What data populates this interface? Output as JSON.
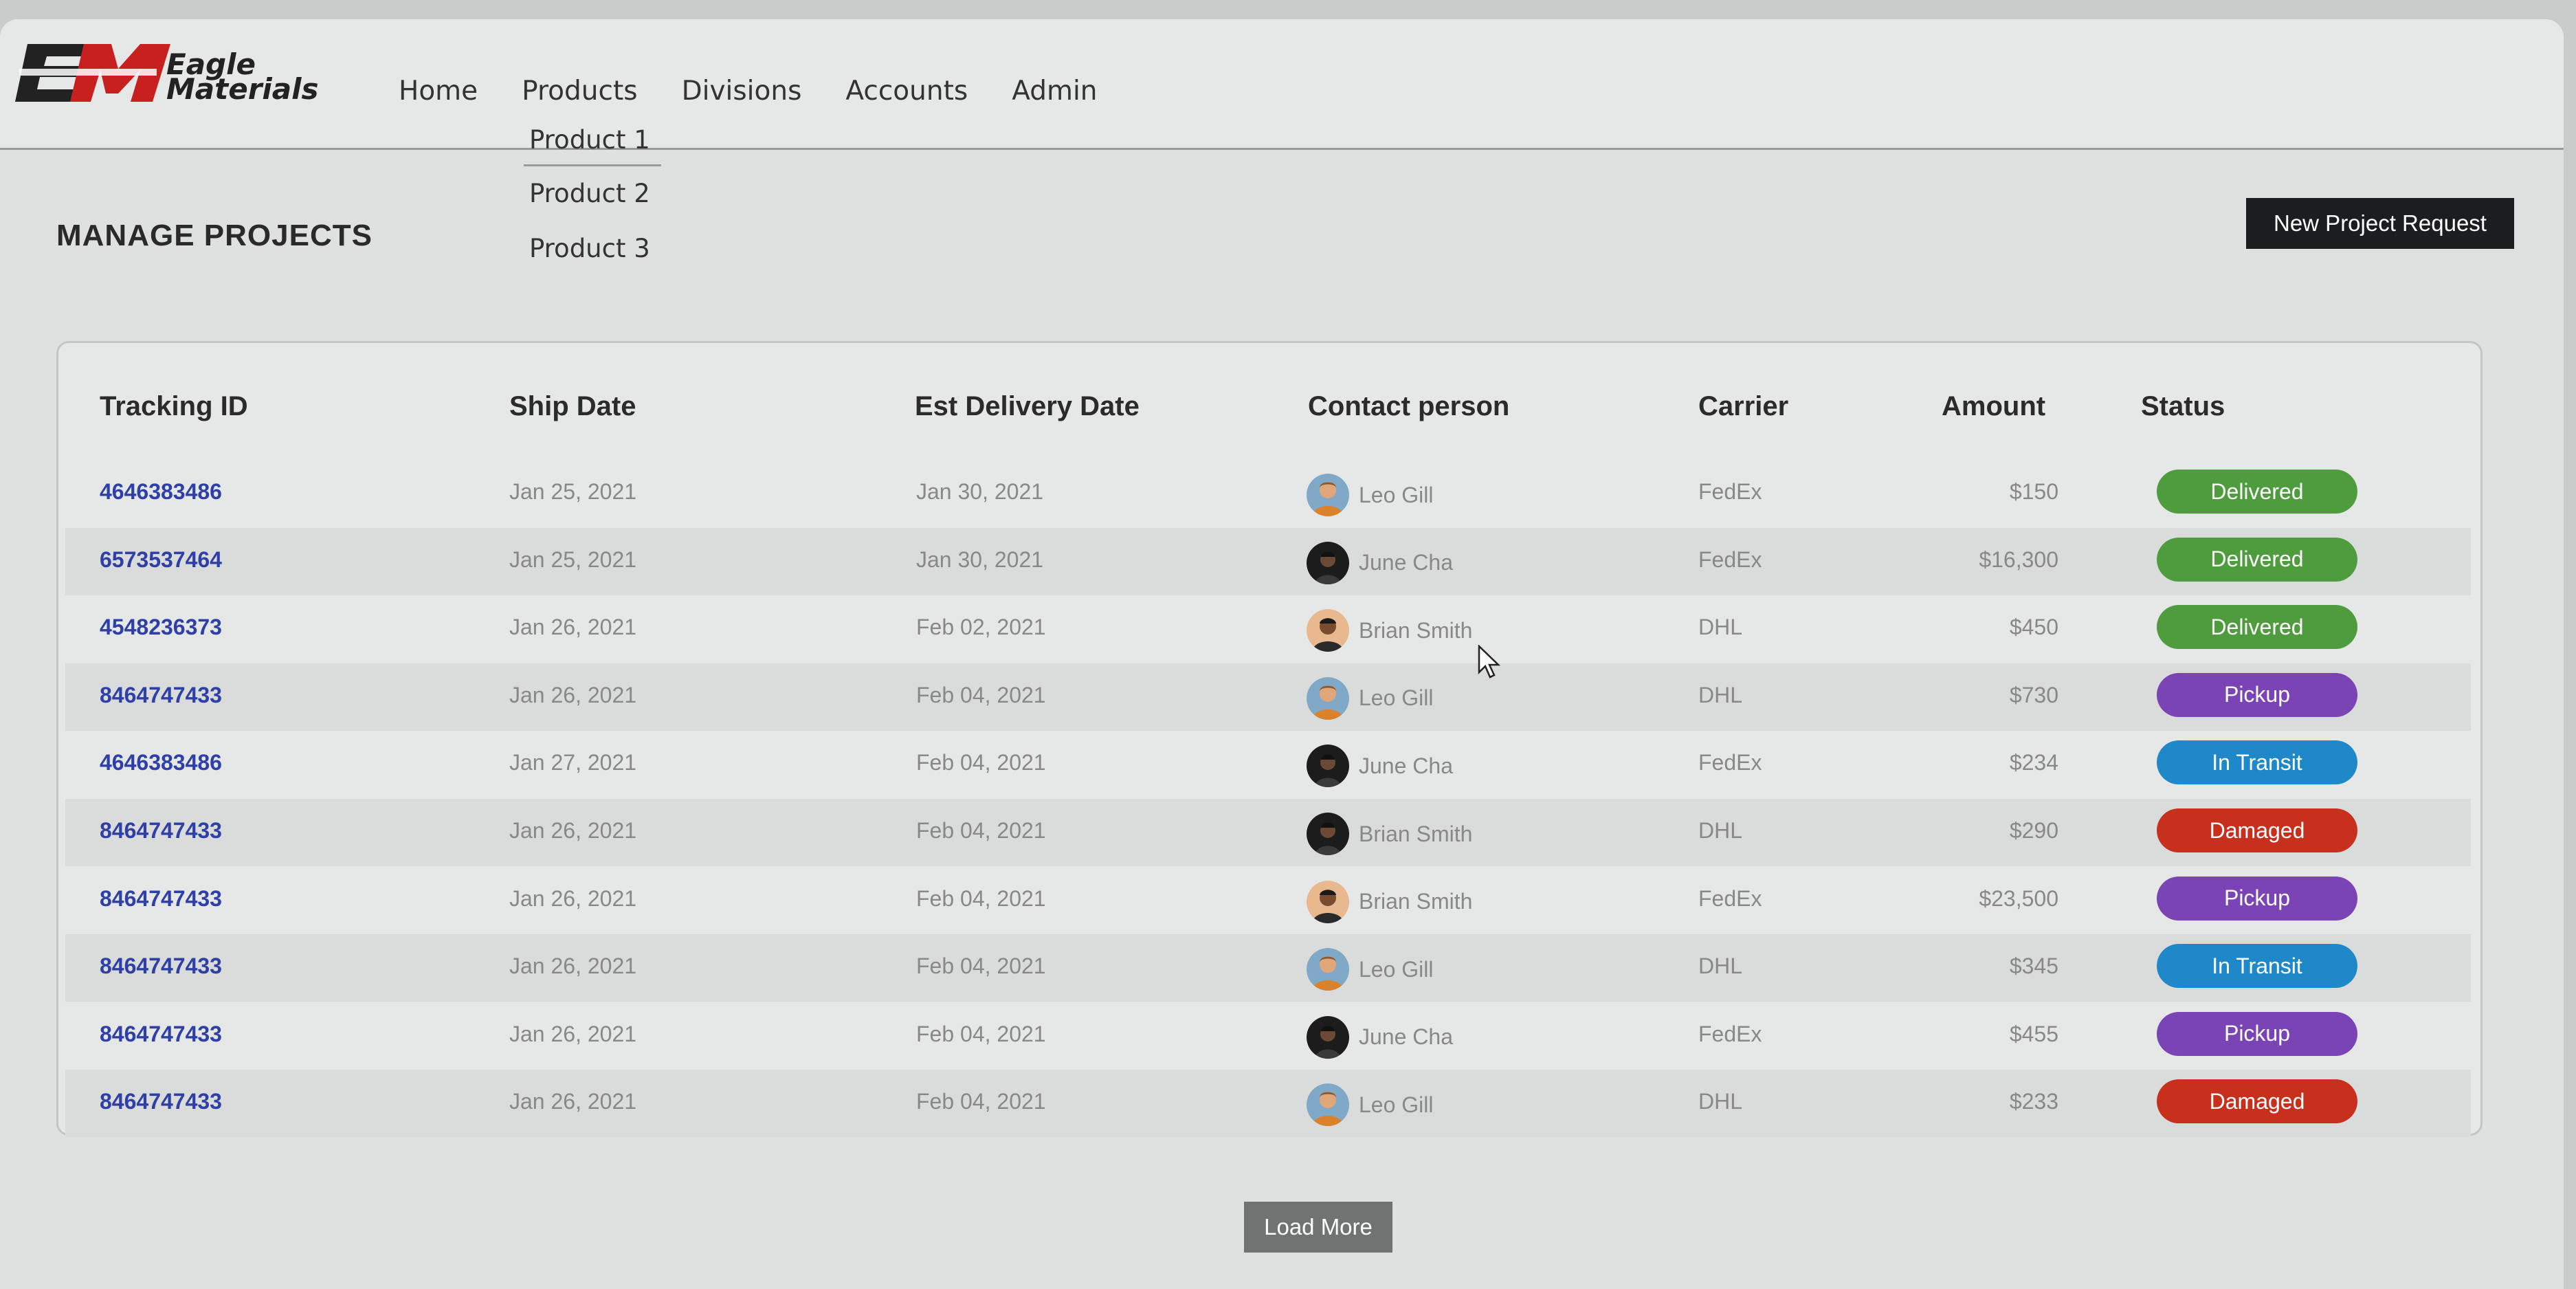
{
  "brand": {
    "name_line1": "Eagle",
    "name_line2": "Materials"
  },
  "nav": {
    "items": [
      "Home",
      "Products",
      "Divisions",
      "Accounts",
      "Admin"
    ],
    "products_dropdown": [
      "Product 1",
      "Product 2",
      "Product 3"
    ]
  },
  "page": {
    "title": "MANAGE PROJECTS",
    "new_button": "New Project Request",
    "load_more": "Load More"
  },
  "table": {
    "columns": [
      "Tracking ID",
      "Ship Date",
      "Est Delivery Date",
      "Contact person",
      "Carrier",
      "Amount",
      "Status"
    ],
    "rows": [
      {
        "id": "4646383486",
        "ship": "Jan 25, 2021",
        "delivery": "Jan 30, 2021",
        "contact": "Leo Gill",
        "avatar": "light",
        "carrier": "FedEx",
        "amount": "$150",
        "status": "Delivered"
      },
      {
        "id": "6573537464",
        "ship": "Jan 25, 2021",
        "delivery": "Jan 30, 2021",
        "contact": "June Cha",
        "avatar": "dark",
        "carrier": "FedEx",
        "amount": "$16,300",
        "status": "Delivered"
      },
      {
        "id": "4548236373",
        "ship": "Jan 26, 2021",
        "delivery": "Feb 02, 2021",
        "contact": "Brian Smith",
        "avatar": "warm",
        "carrier": "DHL",
        "amount": "$450",
        "status": "Delivered"
      },
      {
        "id": "8464747433",
        "ship": "Jan 26, 2021",
        "delivery": "Feb 04, 2021",
        "contact": "Leo Gill",
        "avatar": "light",
        "carrier": "DHL",
        "amount": "$730",
        "status": "Pickup"
      },
      {
        "id": "4646383486",
        "ship": "Jan 27, 2021",
        "delivery": "Feb 04, 2021",
        "contact": "June Cha",
        "avatar": "dark",
        "carrier": "FedEx",
        "amount": "$234",
        "status": "In Transit"
      },
      {
        "id": "8464747433",
        "ship": "Jan 26, 2021",
        "delivery": "Feb 04, 2021",
        "contact": "Brian Smith",
        "avatar": "dark",
        "carrier": "DHL",
        "amount": "$290",
        "status": "Damaged"
      },
      {
        "id": "8464747433",
        "ship": "Jan 26, 2021",
        "delivery": "Feb 04, 2021",
        "contact": "Brian Smith",
        "avatar": "warm",
        "carrier": "FedEx",
        "amount": "$23,500",
        "status": "Pickup"
      },
      {
        "id": "8464747433",
        "ship": "Jan 26, 2021",
        "delivery": "Feb 04, 2021",
        "contact": "Leo Gill",
        "avatar": "light",
        "carrier": "DHL",
        "amount": "$345",
        "status": "In Transit"
      },
      {
        "id": "8464747433",
        "ship": "Jan 26, 2021",
        "delivery": "Feb 04, 2021",
        "contact": "June Cha",
        "avatar": "dark",
        "carrier": "FedEx",
        "amount": "$455",
        "status": "Pickup"
      },
      {
        "id": "8464747433",
        "ship": "Jan 26, 2021",
        "delivery": "Feb 04, 2021",
        "contact": "Leo Gill",
        "avatar": "light",
        "carrier": "DHL",
        "amount": "$233",
        "status": "Damaged"
      }
    ]
  },
  "status_colors": {
    "Delivered": "#4f9c3f",
    "Pickup": "#7a44b4",
    "In Transit": "#1e88c8",
    "Damaged": "#c8301e"
  },
  "brand_colors": {
    "red": "#c8201e",
    "dark": "#222222"
  }
}
